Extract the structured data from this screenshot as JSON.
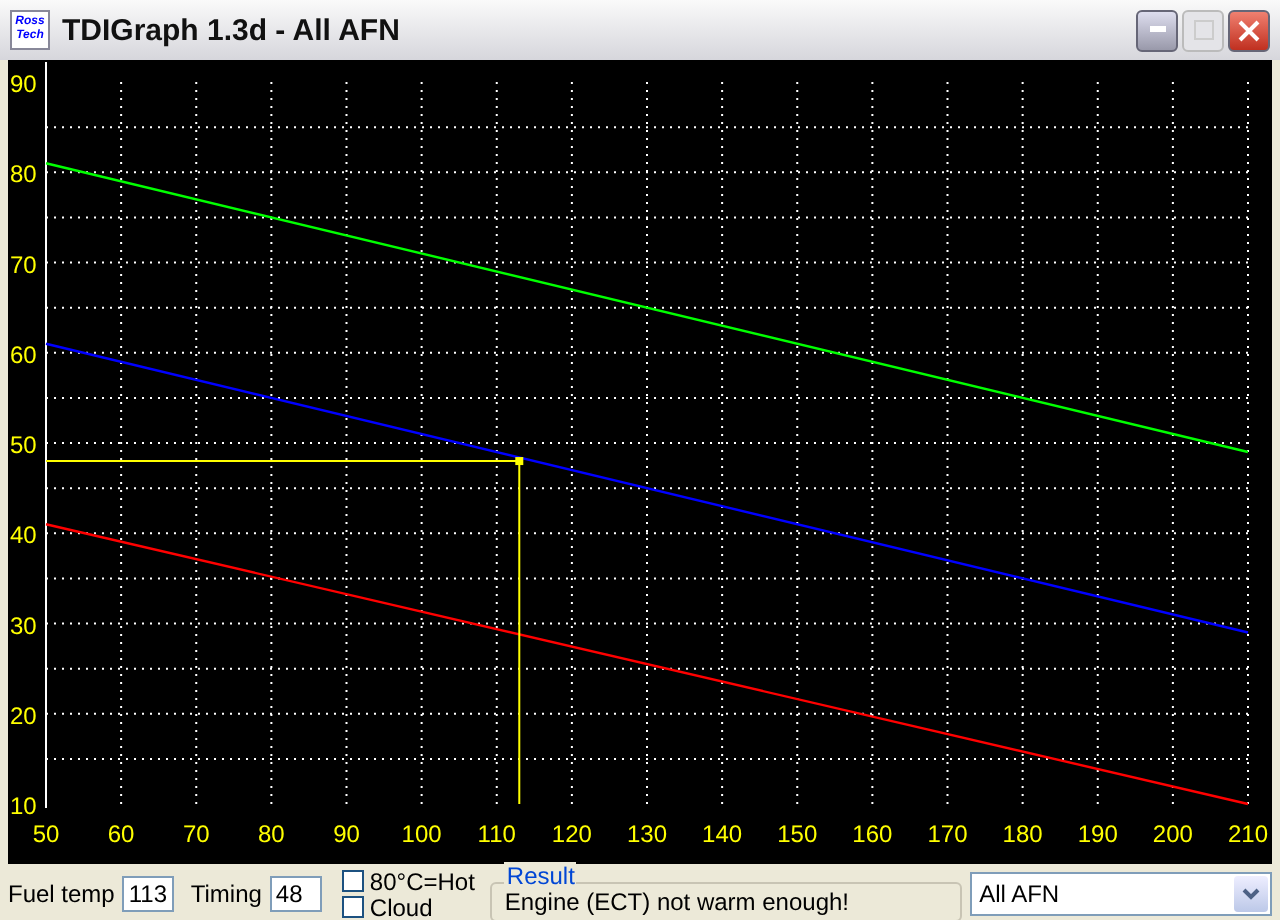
{
  "window": {
    "title": "TDIGraph 1.3d - All AFN",
    "logo_lines": [
      "Ross",
      "Tech"
    ],
    "maximize_disabled": true
  },
  "chart": {
    "chart_data": {
      "type": "line",
      "x": [
        50,
        210
      ],
      "xlim": [
        50,
        210
      ],
      "ylim": [
        10,
        90
      ],
      "xticks": [
        50,
        60,
        70,
        80,
        90,
        100,
        110,
        120,
        130,
        140,
        150,
        160,
        170,
        180,
        190,
        200,
        210
      ],
      "yticks": [
        10,
        20,
        30,
        40,
        50,
        60,
        70,
        80,
        90
      ],
      "series": [
        {
          "color": "#00ff00",
          "values": [
            81,
            49
          ]
        },
        {
          "color": "#0000ff",
          "values": [
            61,
            29
          ]
        },
        {
          "color": "#ff0000",
          "values": [
            41,
            10
          ]
        }
      ],
      "grid": true
    }
  },
  "controls": {
    "fuel_temp": {
      "label": "Fuel temp",
      "value": "113"
    },
    "timing": {
      "label": "Timing",
      "value": "48"
    },
    "checkboxes": [
      {
        "label": "80°C=Hot",
        "checked": false
      },
      {
        "label": "Cloud",
        "checked": false
      }
    ],
    "result": {
      "legend": "Result",
      "text": "Engine (ECT) not warm enough!"
    },
    "dropdown": {
      "value": "All AFN"
    }
  }
}
